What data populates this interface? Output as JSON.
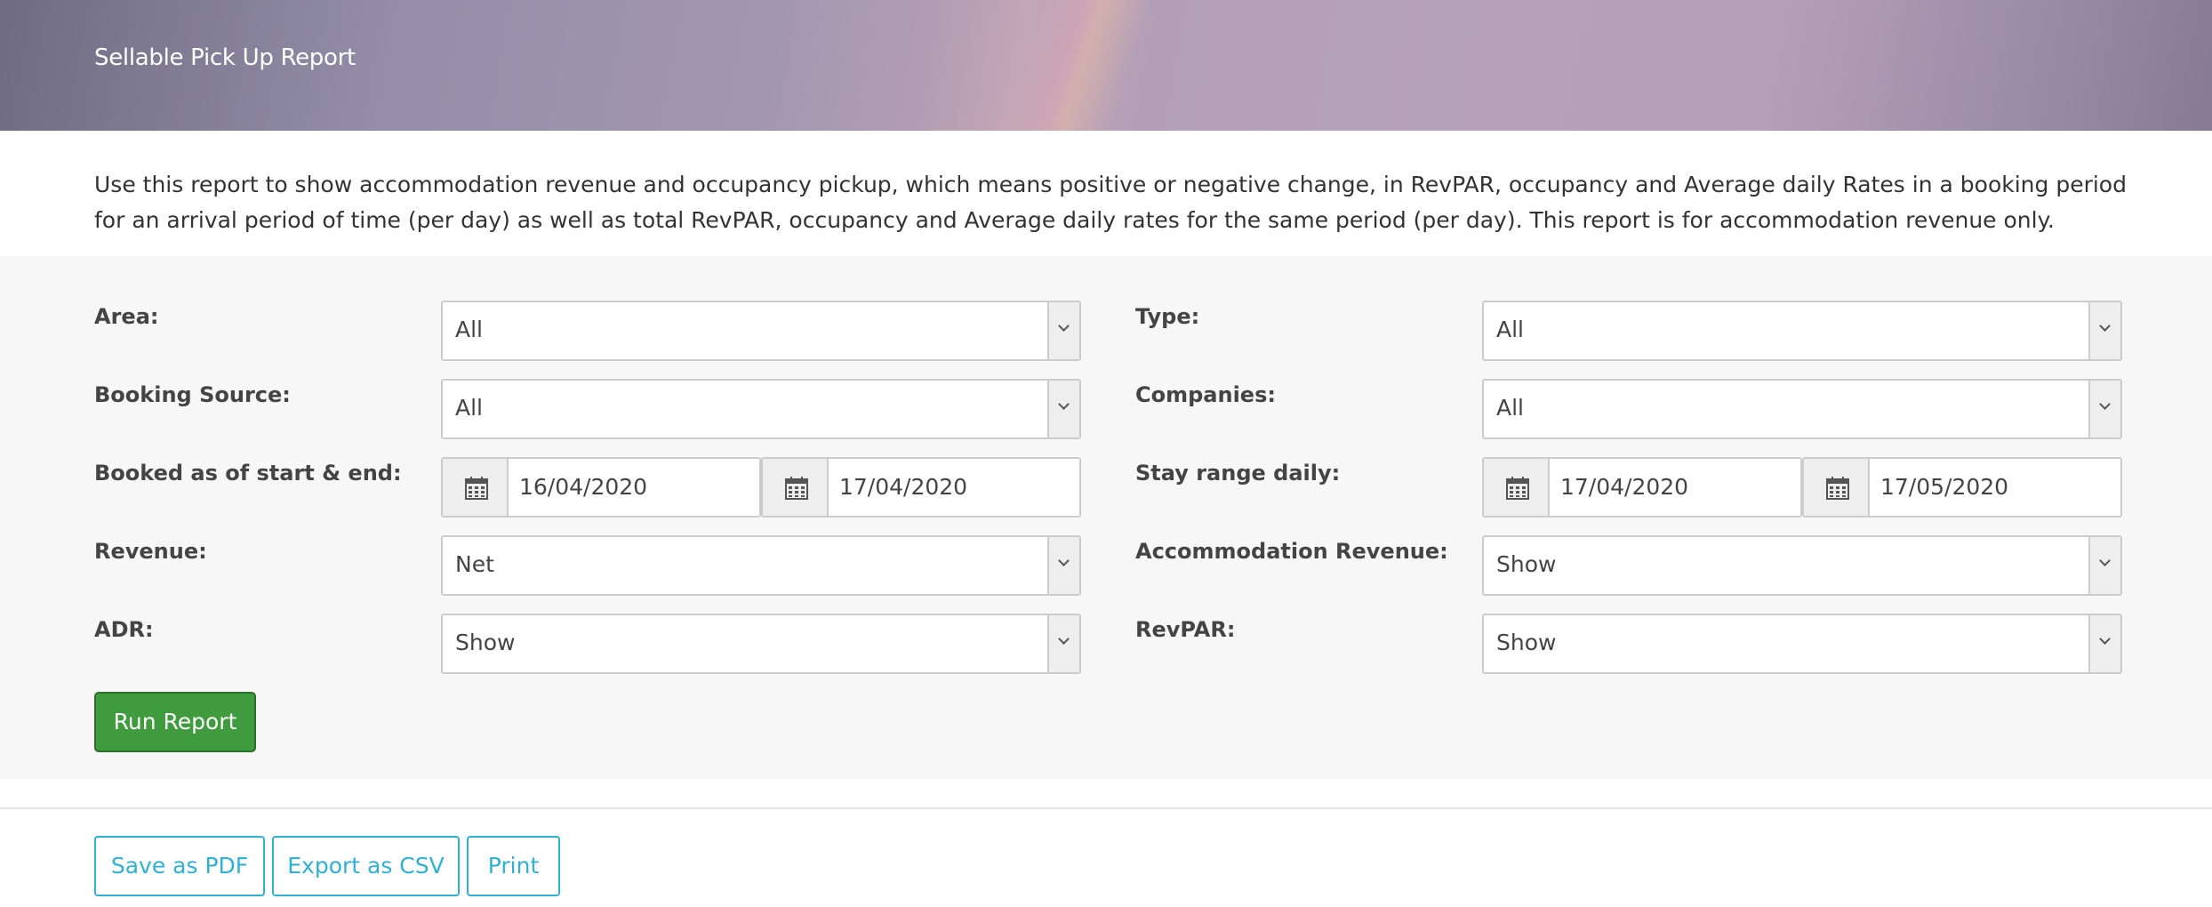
{
  "header": {
    "title": "Sellable Pick Up Report"
  },
  "description": "Use this report to show accommodation revenue and occupancy pickup, which means positive or negative change, in RevPAR, occupancy and Average daily Rates in a booking period for an arrival period of time (per day) as well as total RevPAR, occupancy and Average daily rates for the same period (per day). This report is for accommodation revenue only.",
  "filters": {
    "area": {
      "label": "Area:",
      "value": "All"
    },
    "type": {
      "label": "Type:",
      "value": "All"
    },
    "booking_source": {
      "label": "Booking Source:",
      "value": "All"
    },
    "companies": {
      "label": "Companies:",
      "value": "All"
    },
    "booked_as_of": {
      "label": "Booked as of start & end:",
      "start": "16/04/2020",
      "end": "17/04/2020"
    },
    "stay_range": {
      "label": "Stay range daily:",
      "start": "17/04/2020",
      "end": "17/05/2020"
    },
    "revenue": {
      "label": "Revenue:",
      "value": "Net"
    },
    "accommodation_revenue": {
      "label": "Accommodation Revenue:",
      "value": "Show"
    },
    "adr": {
      "label": "ADR:",
      "value": "Show"
    },
    "revpar": {
      "label": "RevPAR:",
      "value": "Show"
    }
  },
  "actions": {
    "run_report": "Run Report",
    "save_pdf": "Save as PDF",
    "export_csv": "Export as CSV",
    "print": "Print"
  },
  "icons": {
    "date_addon": "calendar-icon",
    "select_caret": "chevron-down-icon"
  },
  "colors": {
    "run_button": "#3f9b3d",
    "output_button": "#31b0d5",
    "panel_bg": "#f7f7f7"
  }
}
